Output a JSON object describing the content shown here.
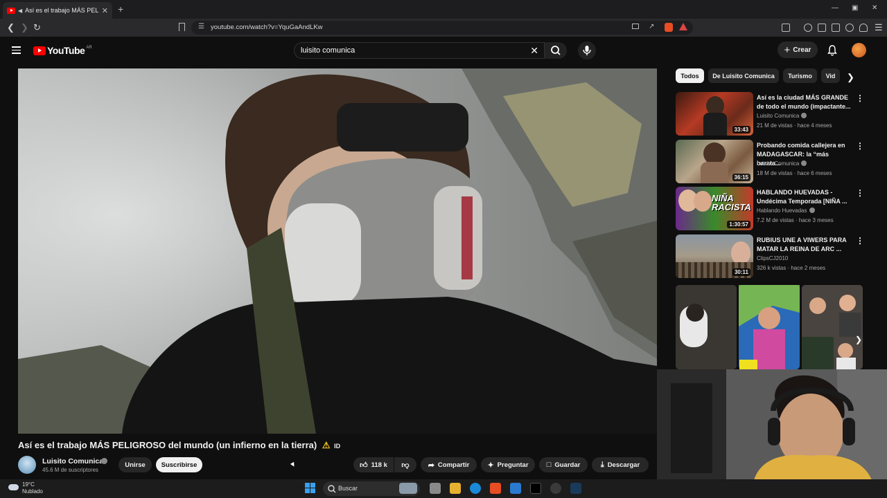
{
  "browser": {
    "tab_title": "Así es el trabajo MÁS PELIGR",
    "url": "youtube.com/watch?v=YquGaAndLKw"
  },
  "youtube": {
    "logo_text": "YouTube",
    "logo_country": "AR",
    "search_query": "luisito comunica",
    "create_label": "Crear"
  },
  "video": {
    "title": "Así es el trabajo MÁS PELIGROSO del mundo (un infierno en la tierra)",
    "title_badge": "ID",
    "channel_name": "Luisito Comunica",
    "subscribers": "45.6 M de suscriptores",
    "join_label": "Unirse",
    "subscribe_label": "Suscribirse",
    "likes": "118 k",
    "share_label": "Compartir",
    "ask_label": "Preguntar",
    "save_label": "Guardar",
    "download_label": "Descargar"
  },
  "chips": [
    "Todos",
    "De Luisito Comunica",
    "Turismo",
    "Vid"
  ],
  "recommendations": [
    {
      "title": "Así es la ciudad MÁS GRANDE de todo el mundo (impactante...",
      "channel": "Luisito Comunica",
      "meta": "21 M de vistas · hace 4 meses",
      "duration": "33:43"
    },
    {
      "title": "Probando comida callejera en MADAGASCAR: la “más barata...",
      "channel": "Luisito Comunica",
      "meta": "18 M de vistas · hace 6 meses",
      "duration": "36:15"
    },
    {
      "title": "HABLANDO HUEVADAS - Undécima Temporada [NIÑA ...",
      "channel": "Hablando Huevadas",
      "meta": "7.2 M de vistas · hace 3 meses",
      "duration": "1:30:57",
      "thumb_text": "NIÑA RACISTA"
    },
    {
      "title": "RUBIUS UNE A VIWERS PARA MATAR LA REINA DE ARC ...",
      "channel": "ClipsCJ2010",
      "meta": "326 k vistas · hace 2 meses",
      "duration": "30:11"
    }
  ],
  "taskbar": {
    "temperature": "19°C",
    "weather": "Nublado",
    "search_label": "Buscar"
  },
  "colors": {
    "background": "#0f0f0f",
    "youtube_red": "#ff0000",
    "chip_active": "#f1f1f1"
  }
}
